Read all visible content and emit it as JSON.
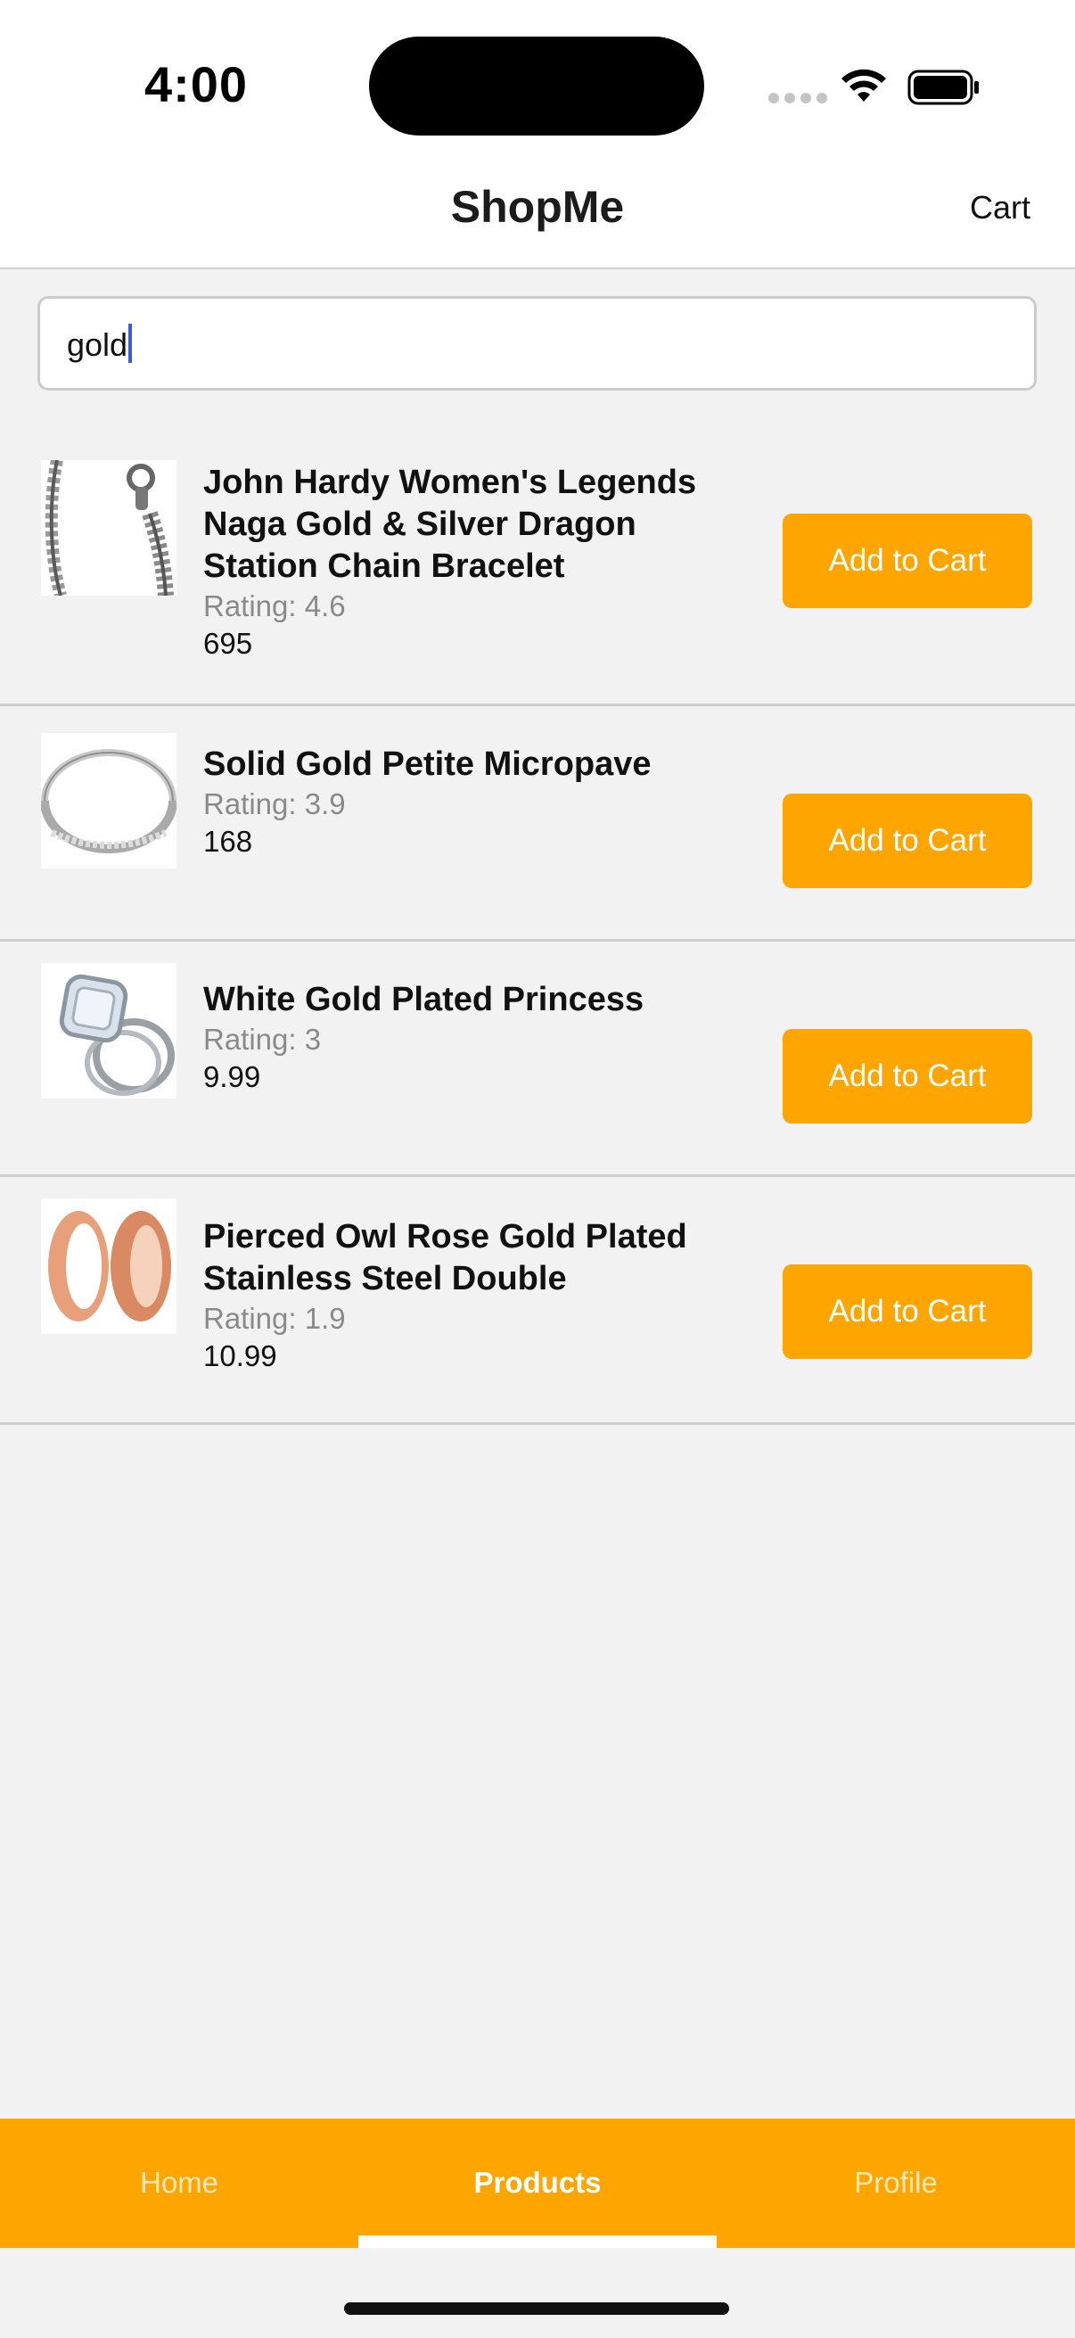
{
  "status_bar": {
    "time": "4:00"
  },
  "header": {
    "title": "ShopMe",
    "cart_label": "Cart"
  },
  "search": {
    "value": "gold"
  },
  "products": [
    {
      "title_lines": [
        "John Hardy Women's Legends",
        "Naga Gold & Silver Dragon",
        "Station Chain Bracelet"
      ],
      "rating": "Rating: 4.6",
      "price": "695",
      "button": "Add to Cart"
    },
    {
      "title_lines": [
        "Solid Gold Petite Micropave"
      ],
      "rating": "Rating: 3.9",
      "price": "168",
      "button": "Add to Cart"
    },
    {
      "title_lines": [
        "White Gold Plated Princess"
      ],
      "rating": "Rating: 3",
      "price": "9.99",
      "button": "Add to Cart"
    },
    {
      "title_lines": [
        "Pierced Owl Rose Gold Plated",
        "Stainless Steel Double"
      ],
      "rating": "Rating: 1.9",
      "price": "10.99",
      "button": "Add to Cart"
    }
  ],
  "tabs": [
    {
      "label": "Home",
      "active": false
    },
    {
      "label": "Products",
      "active": true
    },
    {
      "label": "Profile",
      "active": false
    }
  ],
  "colors": {
    "accent": "#ffa500",
    "background": "#f2f2f2",
    "caret": "#3b5bdb"
  },
  "icons": [
    "signal-icon",
    "wifi-icon",
    "battery-icon",
    "bracelet-icon",
    "ring-band-icon",
    "diamond-ring-icon",
    "rose-gold-plug-icon"
  ]
}
